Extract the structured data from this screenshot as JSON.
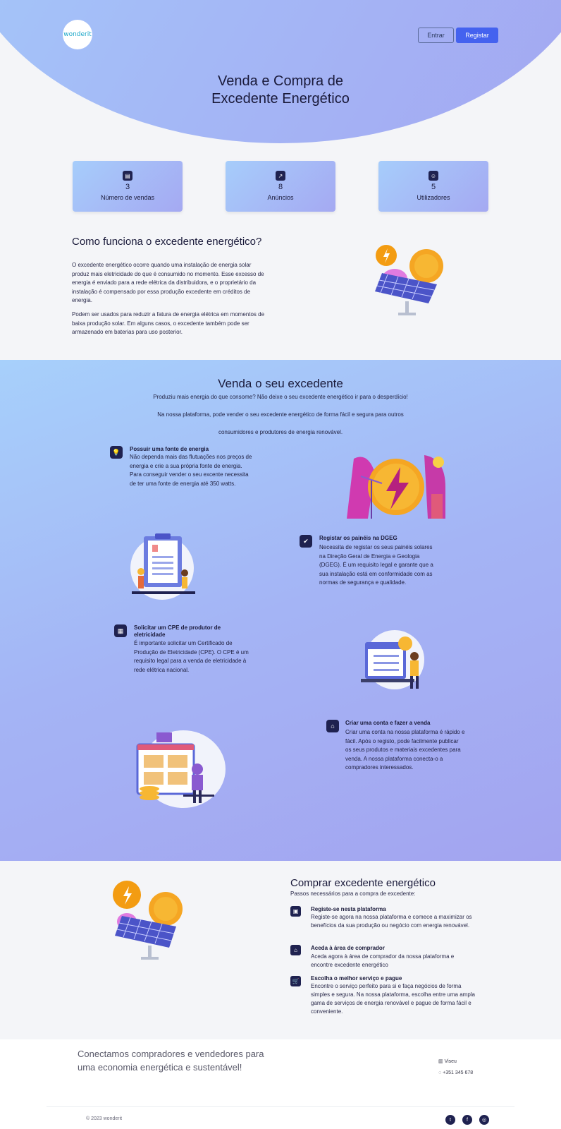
{
  "header": {
    "logo_text": "wonderit",
    "login_label": "Entrar",
    "register_label": "Registar",
    "title_line1": "Venda e Compra de",
    "title_line2": "Excedente Energético"
  },
  "stats": [
    {
      "icon": "sales-icon",
      "value": "3",
      "label": "Número de vendas"
    },
    {
      "icon": "chart-icon",
      "value": "8",
      "label": "Anúncios"
    },
    {
      "icon": "user-icon",
      "value": "5",
      "label": "Utilizadores"
    }
  ],
  "how": {
    "title": "Como funciona o excedente energético?",
    "p1": "O excedente energético ocorre quando uma instalação de energia solar produz mais eletricidade do que é consumido no momento. Esse excesso de energia é enviado para a rede elétrica da distribuidora, e o proprietário da instalação é compensado por essa produção excedente em créditos de energia.",
    "p2": "Podem ser usados para reduzir a fatura de energia elétrica em momentos de baixa produção solar. Em alguns casos, o excedente também pode ser armazenado em baterias para uso posterior."
  },
  "sell": {
    "title": "Venda o seu excedente",
    "sub1": "Produziu mais energia do que consome? Não deixe o seu excedente energético ir para o desperdício!",
    "sub2": "Na nossa plataforma, pode vender o seu excedente energético de forma fácil e segura para outros",
    "sub3": "consumidores e produtores de energia renovável.",
    "steps": [
      {
        "icon": "lightbulb-icon",
        "title": "Possuir uma fonte de energia",
        "text": "Não dependa mais das flutuações nos preços de energia e crie a sua própria fonte de energia. Para conseguir vender o seu excente necessita de ter uma fonte de energia até 350 watts."
      },
      {
        "icon": "clipboard-check-icon",
        "title": "Registar os painéis na DGEG",
        "text": "Necessita de registar os seus painéis solares na Direção Geral de Energia e Geologia (DGEG). É um requisito legal e garante que a sua instalação está em conformidade com as normas de segurança e qualidade."
      },
      {
        "icon": "document-icon",
        "title": "Solicitar um CPE de produtor de eletricidade",
        "text": "É importante solicitar um Certificado de Produção de Eletricidade (CPE). O CPE é um requisito legal para a venda de eletricidade à rede elétrica nacional."
      },
      {
        "icon": "house-user-icon",
        "title": "Criar uma conta e fazer a venda",
        "text": "Criar uma conta na nossa plataforma é rápido e fácil. Após o registo, pode facilmente publicar os seus produtos e materiais excedentes para venda. A nossa plataforma conecta-o a compradores interessados."
      }
    ]
  },
  "buy": {
    "title": "Comprar excedente energético",
    "subtitle": "Passos necessários para a compra de excedente:",
    "steps": [
      {
        "icon": "clipboard-icon",
        "title": "Registe-se nesta plataforma",
        "text": "Registe-se agora na nossa plataforma e comece a maximizar os benefícios da sua produção ou negócio com energia renovável."
      },
      {
        "icon": "storefront-icon",
        "title": "Aceda à área de comprador",
        "text": "Aceda agora à área de comprador da nossa plataforma e encontre excedente energético"
      },
      {
        "icon": "cart-icon",
        "title": "Escolha o melhor serviço e pague",
        "text": "Encontre o serviço perfeito para si e faça negócios de forma simples e segura. Na nossa plataforma, escolha entre uma ampla gama de serviços de energia renovável e pague de forma fácil e conveniente."
      }
    ]
  },
  "footer": {
    "slogan": "Conectamos compradores e vendedores para uma economia energética e sustentável!",
    "location": "Viseu",
    "phone": "+351 345 678",
    "copyright": "© 2023 wonderit",
    "social": [
      "twitter-icon",
      "facebook-icon",
      "instagram-icon"
    ]
  }
}
